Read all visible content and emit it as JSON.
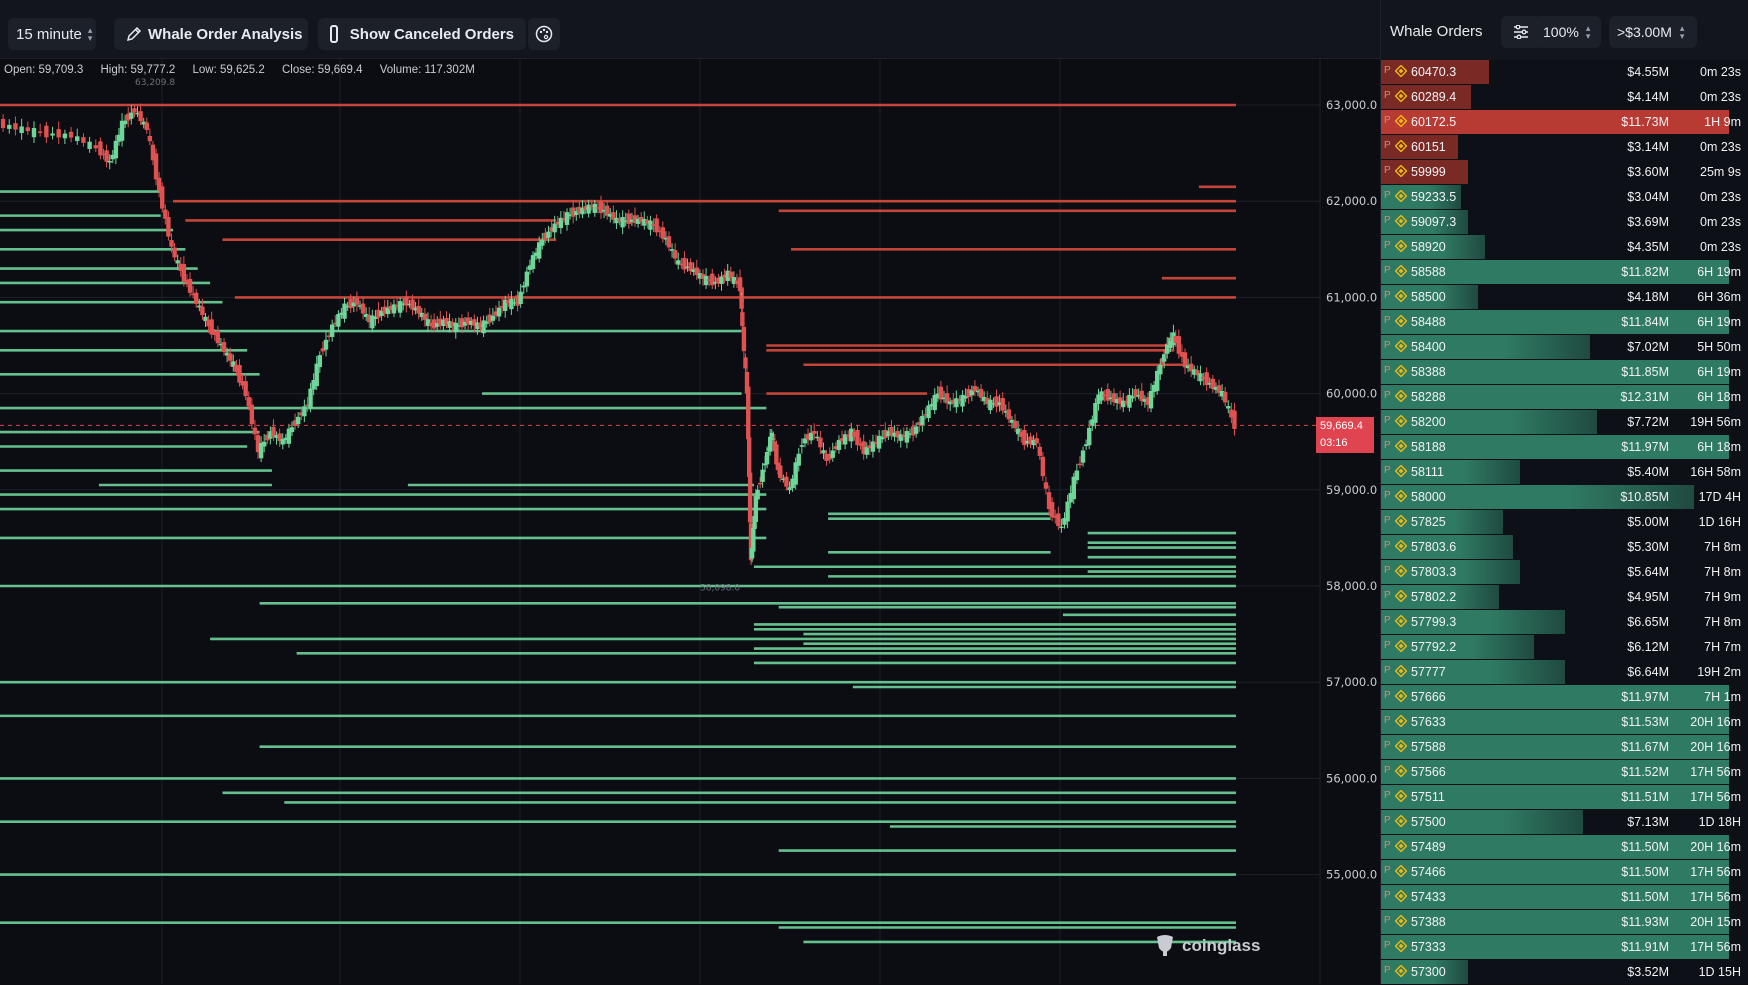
{
  "toolbar": {
    "interval_label": "15 minute",
    "whale_analysis_label": "Whale Order Analysis",
    "show_canceled_label": "Show Canceled Orders",
    "show_canceled_checked": false
  },
  "ohlc": {
    "open": "Open: 59,709.3",
    "high": "High: 59,777.2",
    "low": "Low: 59,625.2",
    "close": "Close: 59,669.4",
    "volume": "Volume: 117.302M"
  },
  "chart": {
    "current_price": "59,669.4",
    "countdown": "03:16",
    "high_marker": "63,209.8",
    "low_marker": "58,098.0",
    "y_ticks": [
      "63,000.0",
      "62,000.0",
      "61,000.0",
      "60,000.0",
      "59,000.0",
      "58,000.0",
      "57,000.0",
      "56,000.0",
      "55,000.0"
    ],
    "y_tick_values": [
      63000,
      62000,
      61000,
      60000,
      59000,
      58000,
      57000,
      56000,
      55000
    ],
    "colors": {
      "up": "#6fd69a",
      "down": "#e05252",
      "ask_wall": "#d94a3e",
      "bid_wall": "#6fd49c",
      "grid": "#1c2029",
      "price_line": "#e04450"
    },
    "watermark": "coinglass"
  },
  "chart_data": {
    "type": "candlestick",
    "interval": "15 minute",
    "y_range": [
      54200,
      63500
    ],
    "current_price": 59669.4,
    "ask_walls": [
      {
        "price": 63000,
        "x0": 0.0,
        "x1": 1.0
      },
      {
        "price": 62000,
        "x0": 0.14,
        "x1": 1.0
      },
      {
        "price": 61900,
        "x0": 0.63,
        "x1": 1.0
      },
      {
        "price": 61800,
        "x0": 0.15,
        "x1": 0.45
      },
      {
        "price": 61600,
        "x0": 0.18,
        "x1": 0.45
      },
      {
        "price": 61500,
        "x0": 0.64,
        "x1": 1.0
      },
      {
        "price": 61200,
        "x0": 0.94,
        "x1": 1.0
      },
      {
        "price": 61000,
        "x0": 0.19,
        "x1": 1.0
      },
      {
        "price": 60500,
        "x0": 0.62,
        "x1": 0.95
      },
      {
        "price": 60450,
        "x0": 0.62,
        "x1": 0.95
      },
      {
        "price": 60300,
        "x0": 0.65,
        "x1": 0.96
      },
      {
        "price": 60000,
        "x0": 0.62,
        "x1": 0.75
      },
      {
        "price": 62150,
        "x0": 0.97,
        "x1": 1.0
      }
    ],
    "bid_walls": [
      {
        "price": 62100,
        "x0": 0.0,
        "x1": 0.13
      },
      {
        "price": 61850,
        "x0": 0.0,
        "x1": 0.13
      },
      {
        "price": 61700,
        "x0": 0.0,
        "x1": 0.14
      },
      {
        "price": 61500,
        "x0": 0.0,
        "x1": 0.15
      },
      {
        "price": 61300,
        "x0": 0.0,
        "x1": 0.16
      },
      {
        "price": 61150,
        "x0": 0.0,
        "x1": 0.17
      },
      {
        "price": 60950,
        "x0": 0.0,
        "x1": 0.18
      },
      {
        "price": 60650,
        "x0": 0.0,
        "x1": 0.6
      },
      {
        "price": 60450,
        "x0": 0.0,
        "x1": 0.2
      },
      {
        "price": 60200,
        "x0": 0.0,
        "x1": 0.21
      },
      {
        "price": 60000,
        "x0": 0.39,
        "x1": 0.6
      },
      {
        "price": 59850,
        "x0": 0.0,
        "x1": 0.62
      },
      {
        "price": 59600,
        "x0": 0.0,
        "x1": 0.21
      },
      {
        "price": 59450,
        "x0": 0.0,
        "x1": 0.2
      },
      {
        "price": 59200,
        "x0": 0.0,
        "x1": 0.22
      },
      {
        "price": 59050,
        "x0": 0.08,
        "x1": 0.22
      },
      {
        "price": 59050,
        "x0": 0.33,
        "x1": 0.61
      },
      {
        "price": 58950,
        "x0": 0.0,
        "x1": 0.62
      },
      {
        "price": 58800,
        "x0": 0.0,
        "x1": 0.62
      },
      {
        "price": 58750,
        "x0": 0.67,
        "x1": 0.85
      },
      {
        "price": 58700,
        "x0": 0.67,
        "x1": 0.85
      },
      {
        "price": 58550,
        "x0": 0.88,
        "x1": 1.0
      },
      {
        "price": 58500,
        "x0": 0.0,
        "x1": 0.62
      },
      {
        "price": 58450,
        "x0": 0.88,
        "x1": 1.0
      },
      {
        "price": 58400,
        "x0": 0.88,
        "x1": 1.0
      },
      {
        "price": 58350,
        "x0": 0.67,
        "x1": 0.85
      },
      {
        "price": 58300,
        "x0": 0.88,
        "x1": 1.0
      },
      {
        "price": 58200,
        "x0": 0.61,
        "x1": 1.0
      },
      {
        "price": 58150,
        "x0": 0.88,
        "x1": 1.0
      },
      {
        "price": 58100,
        "x0": 0.67,
        "x1": 1.0
      },
      {
        "price": 58000,
        "x0": 0.0,
        "x1": 1.0
      },
      {
        "price": 57820,
        "x0": 0.21,
        "x1": 1.0
      },
      {
        "price": 57780,
        "x0": 0.63,
        "x1": 1.0
      },
      {
        "price": 57700,
        "x0": 0.86,
        "x1": 1.0
      },
      {
        "price": 57600,
        "x0": 0.61,
        "x1": 1.0
      },
      {
        "price": 57550,
        "x0": 0.61,
        "x1": 1.0
      },
      {
        "price": 57500,
        "x0": 0.65,
        "x1": 1.0
      },
      {
        "price": 57450,
        "x0": 0.17,
        "x1": 1.0
      },
      {
        "price": 57400,
        "x0": 0.65,
        "x1": 1.0
      },
      {
        "price": 57350,
        "x0": 0.61,
        "x1": 1.0
      },
      {
        "price": 57300,
        "x0": 0.24,
        "x1": 1.0
      },
      {
        "price": 57200,
        "x0": 0.61,
        "x1": 1.0
      },
      {
        "price": 57000,
        "x0": 0.0,
        "x1": 1.0
      },
      {
        "price": 56950,
        "x0": 0.69,
        "x1": 1.0
      },
      {
        "price": 56650,
        "x0": 0.0,
        "x1": 1.0
      },
      {
        "price": 56330,
        "x0": 0.21,
        "x1": 1.0
      },
      {
        "price": 56000,
        "x0": 0.0,
        "x1": 1.0
      },
      {
        "price": 55850,
        "x0": 0.18,
        "x1": 1.0
      },
      {
        "price": 55750,
        "x0": 0.23,
        "x1": 1.0
      },
      {
        "price": 55550,
        "x0": 0.0,
        "x1": 1.0
      },
      {
        "price": 55500,
        "x0": 0.72,
        "x1": 1.0
      },
      {
        "price": 55250,
        "x0": 0.63,
        "x1": 1.0
      },
      {
        "price": 55000,
        "x0": 0.0,
        "x1": 1.0
      },
      {
        "price": 54500,
        "x0": 0.0,
        "x1": 1.0
      },
      {
        "price": 54450,
        "x0": 0.63,
        "x1": 1.0
      },
      {
        "price": 54300,
        "x0": 0.65,
        "x1": 1.0
      }
    ],
    "price_path": [
      [
        0.0,
        62800
      ],
      [
        0.02,
        62750
      ],
      [
        0.04,
        62700
      ],
      [
        0.06,
        62680
      ],
      [
        0.08,
        62550
      ],
      [
        0.09,
        62400
      ],
      [
        0.1,
        62800
      ],
      [
        0.11,
        62950
      ],
      [
        0.12,
        62750
      ],
      [
        0.13,
        62100
      ],
      [
        0.14,
        61500
      ],
      [
        0.15,
        61200
      ],
      [
        0.16,
        60950
      ],
      [
        0.17,
        60700
      ],
      [
        0.18,
        60500
      ],
      [
        0.19,
        60300
      ],
      [
        0.2,
        60000
      ],
      [
        0.21,
        59400
      ],
      [
        0.22,
        59600
      ],
      [
        0.23,
        59500
      ],
      [
        0.24,
        59700
      ],
      [
        0.25,
        59900
      ],
      [
        0.26,
        60400
      ],
      [
        0.27,
        60700
      ],
      [
        0.28,
        60900
      ],
      [
        0.29,
        60950
      ],
      [
        0.3,
        60750
      ],
      [
        0.31,
        60850
      ],
      [
        0.32,
        60900
      ],
      [
        0.33,
        60950
      ],
      [
        0.34,
        60850
      ],
      [
        0.35,
        60700
      ],
      [
        0.36,
        60750
      ],
      [
        0.37,
        60700
      ],
      [
        0.38,
        60750
      ],
      [
        0.39,
        60700
      ],
      [
        0.4,
        60800
      ],
      [
        0.41,
        60950
      ],
      [
        0.42,
        60950
      ],
      [
        0.43,
        61350
      ],
      [
        0.44,
        61600
      ],
      [
        0.45,
        61750
      ],
      [
        0.46,
        61850
      ],
      [
        0.47,
        61900
      ],
      [
        0.48,
        61950
      ],
      [
        0.49,
        61900
      ],
      [
        0.5,
        61800
      ],
      [
        0.51,
        61800
      ],
      [
        0.52,
        61800
      ],
      [
        0.53,
        61750
      ],
      [
        0.54,
        61600
      ],
      [
        0.55,
        61350
      ],
      [
        0.56,
        61300
      ],
      [
        0.57,
        61200
      ],
      [
        0.58,
        61150
      ],
      [
        0.59,
        61250
      ],
      [
        0.6,
        61100
      ],
      [
        0.6,
        60900
      ],
      [
        0.605,
        60000
      ],
      [
        0.608,
        58250
      ],
      [
        0.612,
        58900
      ],
      [
        0.62,
        59300
      ],
      [
        0.625,
        59600
      ],
      [
        0.63,
        59200
      ],
      [
        0.64,
        59000
      ],
      [
        0.65,
        59500
      ],
      [
        0.66,
        59600
      ],
      [
        0.67,
        59300
      ],
      [
        0.68,
        59500
      ],
      [
        0.69,
        59600
      ],
      [
        0.7,
        59400
      ],
      [
        0.71,
        59500
      ],
      [
        0.72,
        59600
      ],
      [
        0.73,
        59550
      ],
      [
        0.74,
        59600
      ],
      [
        0.75,
        59800
      ],
      [
        0.76,
        60000
      ],
      [
        0.77,
        59900
      ],
      [
        0.78,
        59950
      ],
      [
        0.79,
        60050
      ],
      [
        0.8,
        59900
      ],
      [
        0.81,
        59900
      ],
      [
        0.82,
        59700
      ],
      [
        0.83,
        59500
      ],
      [
        0.84,
        59500
      ],
      [
        0.85,
        58800
      ],
      [
        0.86,
        58600
      ],
      [
        0.87,
        59100
      ],
      [
        0.88,
        59500
      ],
      [
        0.89,
        60000
      ],
      [
        0.9,
        59950
      ],
      [
        0.91,
        59900
      ],
      [
        0.92,
        60000
      ],
      [
        0.93,
        59900
      ],
      [
        0.94,
        60300
      ],
      [
        0.945,
        60500
      ],
      [
        0.95,
        60600
      ],
      [
        0.96,
        60300
      ],
      [
        0.97,
        60200
      ],
      [
        0.98,
        60100
      ],
      [
        0.99,
        60000
      ],
      [
        1.0,
        59669
      ]
    ]
  },
  "panel": {
    "title": "Whale Orders",
    "zoom": "100%",
    "min_size": ">$3.00M",
    "colors": {
      "ask_bar": "#7a2a25",
      "ask_bar_hl": "#b73a33",
      "bid_bar": "#2f7a63",
      "bid_bar_dim": "#1f4a40"
    },
    "orders": [
      {
        "exchange": "P",
        "price": "60470.3",
        "amount": "$4.55M",
        "age": "0m 23s",
        "side": "ask",
        "fill": 0.31
      },
      {
        "exchange": "P",
        "price": "60289.4",
        "amount": "$4.14M",
        "age": "0m 23s",
        "side": "ask",
        "fill": 0.26
      },
      {
        "exchange": "P",
        "price": "60172.5",
        "amount": "$11.73M",
        "age": "1H 9m",
        "side": "ask_hl",
        "fill": 1.0
      },
      {
        "exchange": "P",
        "price": "60151",
        "amount": "$3.14M",
        "age": "0m 23s",
        "side": "ask",
        "fill": 0.22
      },
      {
        "exchange": "P",
        "price": "59999",
        "amount": "$3.60M",
        "age": "25m 9s",
        "side": "ask",
        "fill": 0.25
      },
      {
        "exchange": "P",
        "price": "59233.5",
        "amount": "$3.04M",
        "age": "0m 23s",
        "side": "bid",
        "fill": 0.23
      },
      {
        "exchange": "P",
        "price": "59097.3",
        "amount": "$3.69M",
        "age": "0m 23s",
        "side": "bid",
        "fill": 0.25
      },
      {
        "exchange": "P",
        "price": "58920",
        "amount": "$4.35M",
        "age": "0m 23s",
        "side": "bid",
        "fill": 0.3
      },
      {
        "exchange": "P",
        "price": "58588",
        "amount": "$11.82M",
        "age": "6H 19m",
        "side": "bid",
        "fill": 1.0
      },
      {
        "exchange": "P",
        "price": "58500",
        "amount": "$4.18M",
        "age": "6H 36m",
        "side": "bid",
        "fill": 0.28
      },
      {
        "exchange": "P",
        "price": "58488",
        "amount": "$11.84M",
        "age": "6H 19m",
        "side": "bid",
        "fill": 1.0
      },
      {
        "exchange": "P",
        "price": "58400",
        "amount": "$7.02M",
        "age": "5H 50m",
        "side": "bid",
        "fill": 0.6
      },
      {
        "exchange": "P",
        "price": "58388",
        "amount": "$11.85M",
        "age": "6H 19m",
        "side": "bid",
        "fill": 1.0
      },
      {
        "exchange": "P",
        "price": "58288",
        "amount": "$12.31M",
        "age": "6H 18m",
        "side": "bid",
        "fill": 1.0
      },
      {
        "exchange": "P",
        "price": "58200",
        "amount": "$7.72M",
        "age": "19H 56m",
        "side": "bid",
        "fill": 0.62
      },
      {
        "exchange": "P",
        "price": "58188",
        "amount": "$11.97M",
        "age": "6H 18m",
        "side": "bid",
        "fill": 1.0
      },
      {
        "exchange": "P",
        "price": "58111",
        "amount": "$5.40M",
        "age": "16H 58m",
        "side": "bid",
        "fill": 0.4
      },
      {
        "exchange": "P",
        "price": "58000",
        "amount": "$10.85M",
        "age": "17D 4H",
        "side": "bid",
        "fill": 0.9
      },
      {
        "exchange": "P",
        "price": "57825",
        "amount": "$5.00M",
        "age": "1D 16H",
        "side": "bid",
        "fill": 0.35
      },
      {
        "exchange": "P",
        "price": "57803.6",
        "amount": "$5.30M",
        "age": "7H 8m",
        "side": "bid",
        "fill": 0.38
      },
      {
        "exchange": "P",
        "price": "57803.3",
        "amount": "$5.64M",
        "age": "7H 8m",
        "side": "bid",
        "fill": 0.4
      },
      {
        "exchange": "P",
        "price": "57802.2",
        "amount": "$4.95M",
        "age": "7H 9m",
        "side": "bid",
        "fill": 0.34
      },
      {
        "exchange": "P",
        "price": "57799.3",
        "amount": "$6.65M",
        "age": "7H 8m",
        "side": "bid",
        "fill": 0.53
      },
      {
        "exchange": "P",
        "price": "57792.2",
        "amount": "$6.12M",
        "age": "7H 7m",
        "side": "bid",
        "fill": 0.44
      },
      {
        "exchange": "P",
        "price": "57777",
        "amount": "$6.64M",
        "age": "19H 2m",
        "side": "bid",
        "fill": 0.53
      },
      {
        "exchange": "P",
        "price": "57666",
        "amount": "$11.97M",
        "age": "7H 1m",
        "side": "bid",
        "fill": 1.0
      },
      {
        "exchange": "P",
        "price": "57633",
        "amount": "$11.53M",
        "age": "20H 16m",
        "side": "bid",
        "fill": 1.0
      },
      {
        "exchange": "P",
        "price": "57588",
        "amount": "$11.67M",
        "age": "20H 16m",
        "side": "bid",
        "fill": 1.0
      },
      {
        "exchange": "P",
        "price": "57566",
        "amount": "$11.52M",
        "age": "17H 56m",
        "side": "bid",
        "fill": 1.0
      },
      {
        "exchange": "P",
        "price": "57511",
        "amount": "$11.51M",
        "age": "17H 56m",
        "side": "bid",
        "fill": 1.0
      },
      {
        "exchange": "P",
        "price": "57500",
        "amount": "$7.13M",
        "age": "1D 18H",
        "side": "bid",
        "fill": 0.58
      },
      {
        "exchange": "P",
        "price": "57489",
        "amount": "$11.50M",
        "age": "20H 16m",
        "side": "bid",
        "fill": 1.0
      },
      {
        "exchange": "P",
        "price": "57466",
        "amount": "$11.50M",
        "age": "17H 56m",
        "side": "bid",
        "fill": 1.0
      },
      {
        "exchange": "P",
        "price": "57433",
        "amount": "$11.50M",
        "age": "17H 56m",
        "side": "bid",
        "fill": 1.0
      },
      {
        "exchange": "P",
        "price": "57388",
        "amount": "$11.93M",
        "age": "20H 15m",
        "side": "bid",
        "fill": 1.0
      },
      {
        "exchange": "P",
        "price": "57333",
        "amount": "$11.91M",
        "age": "17H 56m",
        "side": "bid",
        "fill": 1.0
      },
      {
        "exchange": "P",
        "price": "57300",
        "amount": "$3.52M",
        "age": "1D 15H",
        "side": "bid",
        "fill": 0.25
      }
    ]
  }
}
